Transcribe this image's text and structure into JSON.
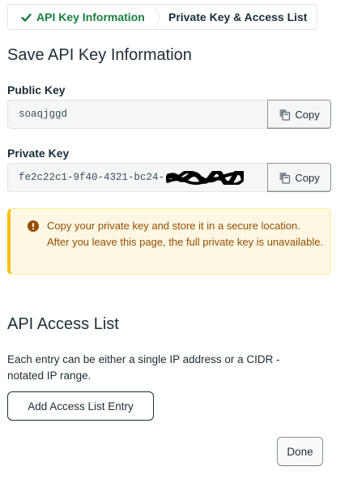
{
  "stepper": {
    "steps": [
      {
        "label": "API Key Information",
        "status": "complete",
        "icon": "check-icon"
      },
      {
        "label": "Private Key & Access List",
        "status": "current"
      }
    ]
  },
  "page_title": "Save API Key Information",
  "public_key": {
    "label": "Public Key",
    "value": "soaqjggd",
    "copy_label": "Copy",
    "copy_icon": "copy-icon"
  },
  "private_key": {
    "label": "Private Key",
    "value_visible": "fe2c22c1-9f40-4321-bc24-",
    "copy_label": "Copy",
    "copy_icon": "copy-icon"
  },
  "warning": {
    "icon": "warning-icon",
    "text": "Copy your private key and store it in a secure location. After you leave this page, the full private key is unavailable."
  },
  "access_list": {
    "title": "API Access List",
    "description": "Each entry can be either a single IP address or a CIDR - notated IP range.",
    "add_button_label": "Add Access List Entry"
  },
  "done_button_label": "Done",
  "colors": {
    "success_green": "#1a7f3f",
    "warning_bg": "#fef7e3",
    "warning_border": "#ffc010",
    "warning_text": "#944f01",
    "text_primary": "#1c2d38"
  }
}
